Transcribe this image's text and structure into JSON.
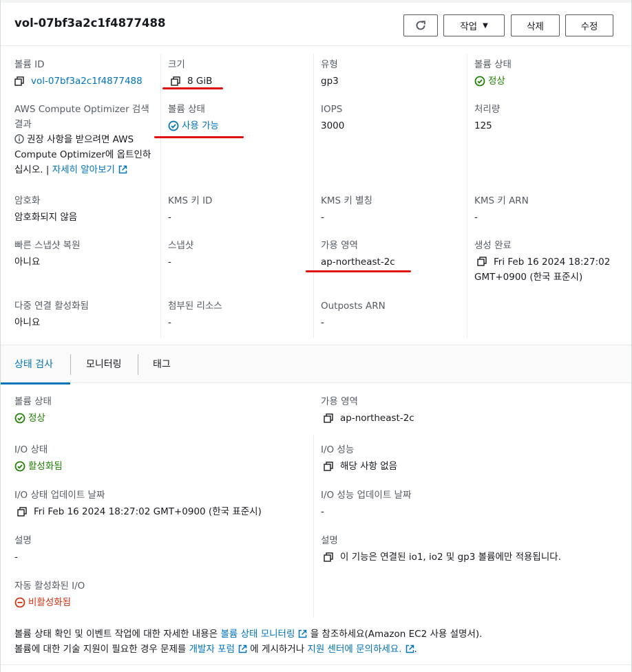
{
  "header": {
    "title": "vol-07bf3a2c1f4877488",
    "refresh_icon": "refresh-icon",
    "actions_label": "작업",
    "delete_label": "삭제",
    "modify_label": "수정"
  },
  "details": {
    "volume_id_label": "볼륨 ID",
    "volume_id_value": "vol-07bf3a2c1f4877488",
    "size_label": "크기",
    "size_value": "8 GiB",
    "type_label": "유형",
    "type_value": "gp3",
    "volume_status_label": "볼륨 상태",
    "volume_status_value": "정상",
    "optimizer_label": "AWS Compute Optimizer 검색 결과",
    "optimizer_text": "권장 사항을 받으려면 AWS Compute Optimizer에 옵트인하십시오. | ",
    "optimizer_link": "자세히 알아보기",
    "volume_state_label": "볼륨 상태",
    "volume_state_value": "사용 가능",
    "iops_label": "IOPS",
    "iops_value": "3000",
    "throughput_label": "처리량",
    "throughput_value": "125",
    "encryption_label": "암호화",
    "encryption_value": "암호화되지 않음",
    "kms_id_label": "KMS 키 ID",
    "kms_id_value": "-",
    "kms_alias_label": "KMS 키 별칭",
    "kms_alias_value": "-",
    "kms_arn_label": "KMS 키 ARN",
    "kms_arn_value": "-",
    "fast_restore_label": "빠른 스냅샷 복원",
    "fast_restore_value": "아니요",
    "snapshot_label": "스냅샷",
    "snapshot_value": "-",
    "az_label": "가용 영역",
    "az_value": "ap-northeast-2c",
    "created_label": "생성 완료",
    "created_value": "Fri Feb 16 2024 18:27:02 GMT+0900 (한국 표준시)",
    "multi_attach_label": "다중 연결 활성화됨",
    "multi_attach_value": "아니요",
    "attached_label": "첨부된 리소스",
    "attached_value": "-",
    "outposts_label": "Outposts ARN",
    "outposts_value": "-"
  },
  "tabs": [
    {
      "label": "상태 검사"
    },
    {
      "label": "모니터링"
    },
    {
      "label": "태그"
    }
  ],
  "status": {
    "vol_status_label": "볼륨 상태",
    "vol_status_value": "정상",
    "az_label": "가용 영역",
    "az_value": "ap-northeast-2c",
    "io_status_label": "I/O 상태",
    "io_status_value": "활성화됨",
    "io_perf_label": "I/O 성능",
    "io_perf_value": "해당 사항 없음",
    "io_update_label": "I/O 상태 업데이트 날짜",
    "io_update_value": "Fri Feb 16 2024 18:27:02 GMT+0900 (한국 표준시)",
    "io_perf_update_label": "I/O 성능 업데이트 날짜",
    "io_perf_update_value": "-",
    "desc_label": "설명",
    "desc_value": "-",
    "desc2_label": "설명",
    "desc2_value": "이 기능은 연결된 io1, io2 및 gp3 볼륨에만 적용됩니다.",
    "auto_io_label": "자동 활성화된 I/O",
    "auto_io_value": "비활성화됨"
  },
  "footer": {
    "line1_pre": "볼륨 상태 확인 및 이벤트 작업에 대한 자세한 내용은 ",
    "line1_link": "볼륨 상태 모니터링",
    "line1_post": " 을 참조하세요(Amazon EC2 사용 설명서).",
    "line2_pre": "볼륨에 대한 기술 지원이 필요한 경우 문제를 ",
    "line2_link1": "개발자 포럼",
    "line2_mid": " 에 게시하거나 ",
    "line2_link2": "지원 센터에 문의하세요.",
    "line2_post": "."
  },
  "colors": {
    "link": "#0073bb",
    "success": "#1d8102",
    "error": "#d13212",
    "annotation": "#e01010"
  }
}
